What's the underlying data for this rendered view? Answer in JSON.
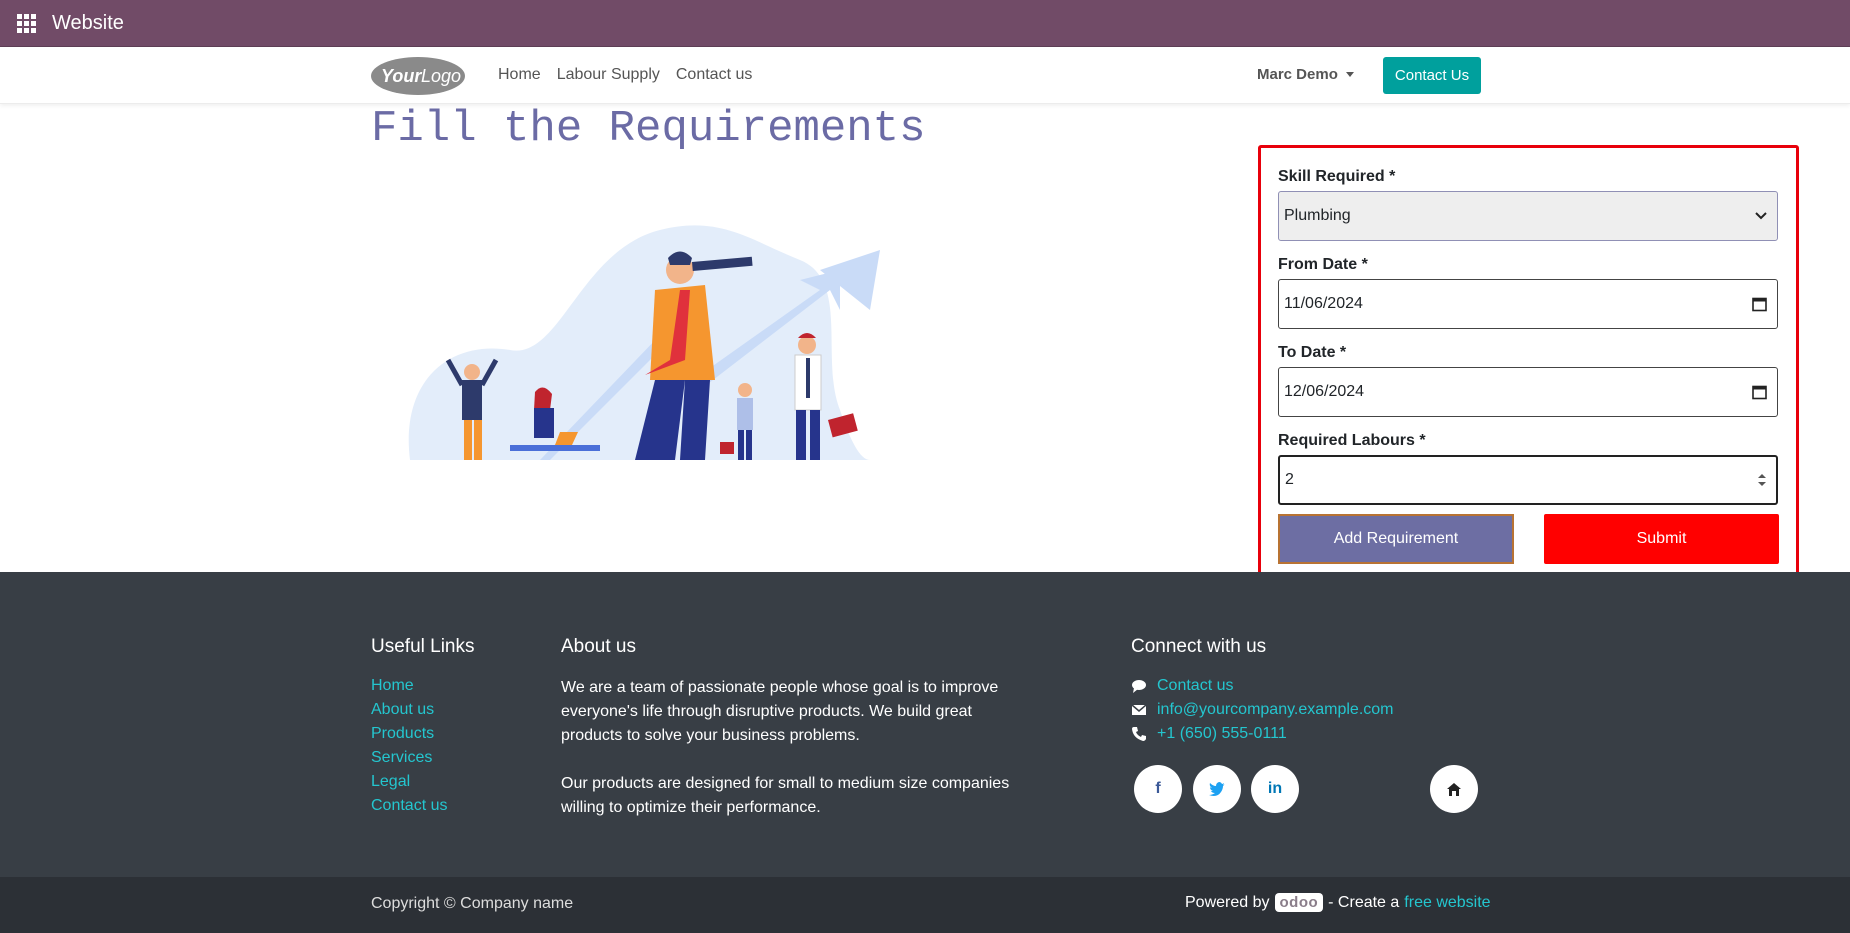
{
  "appbar": {
    "title": "Website"
  },
  "header": {
    "logo_text": "YourLogo",
    "nav": [
      "Home",
      "Labour Supply",
      "Contact us"
    ],
    "user": "Marc Demo",
    "cta": "Contact Us"
  },
  "main": {
    "title": "Fill the Requirements",
    "form": {
      "skill_label": "Skill Required *",
      "skill_value": "Plumbing",
      "from_label": "From Date *",
      "from_value": "11/06/2024",
      "to_label": "To Date *",
      "to_value": "12/06/2024",
      "labours_label": "Required Labours *",
      "labours_value": "2",
      "add_button": "Add Requirement",
      "submit_button": "Submit"
    }
  },
  "footer": {
    "useful_title": "Useful Links",
    "links": [
      "Home",
      "About us",
      "Products",
      "Services",
      "Legal",
      "Contact us"
    ],
    "about_title": "About us",
    "about_p1": "We are a team of passionate people whose goal is to improve everyone's life through disruptive products. We build great products to solve your business problems.",
    "about_p2": "Our products are designed for small to medium size companies willing to optimize their performance.",
    "connect_title": "Connect with us",
    "contact_link": "Contact us",
    "email": "info@yourcompany.example.com",
    "phone": "+1 (650) 555-0111",
    "social": {
      "facebook": "f",
      "linkedin": "in"
    }
  },
  "subfooter": {
    "copyright": "Copyright © Company name",
    "powered_by": "Powered by",
    "odoo": "odoo",
    "create_a": "- Create a",
    "free_website": "free website"
  },
  "colors": {
    "appbar": "#714b67",
    "accent": "#00a09d",
    "link": "#24c6cf",
    "submit": "#ff0000",
    "add": "#6d6ea3",
    "highlight": "#e8000b"
  }
}
